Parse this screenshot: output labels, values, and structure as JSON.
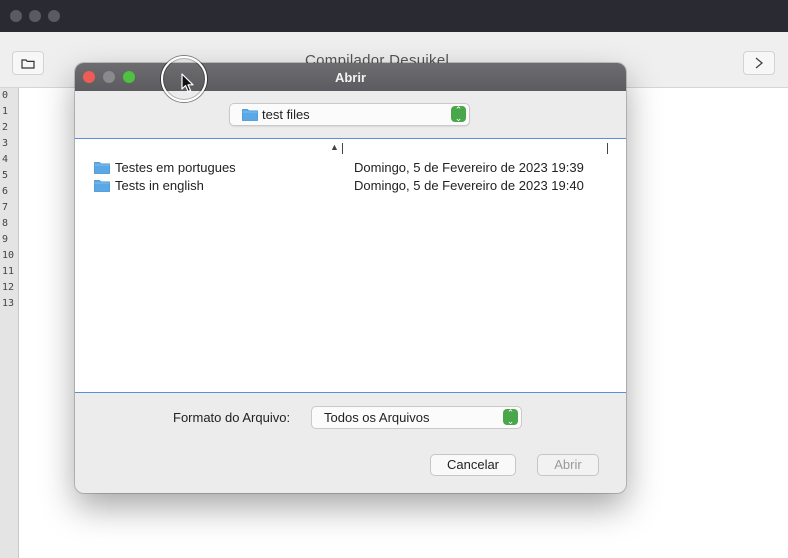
{
  "main_window": {
    "title": "Compilador Desuikel",
    "line_numbers": [
      "0",
      "1",
      "2",
      "3",
      "4",
      "5",
      "6",
      "7",
      "8",
      "9",
      "10",
      "11",
      "12",
      "13"
    ]
  },
  "dialog": {
    "title": "Abrir",
    "location": "test files",
    "files": [
      {
        "name": "Testes em portugues",
        "date": "Domingo, 5 de Fevereiro de 2023 19:39"
      },
      {
        "name": "Tests in english",
        "date": "Domingo, 5 de Fevereiro de 2023 19:40"
      }
    ],
    "format_label": "Formato do Arquivo:",
    "format_value": "Todos os Arquivos",
    "cancel_label": "Cancelar",
    "open_label": "Abrir"
  },
  "colors": {
    "accent": "#4aa64a",
    "folder": "#5aa9e6",
    "selection_border": "#5b8ddb"
  }
}
